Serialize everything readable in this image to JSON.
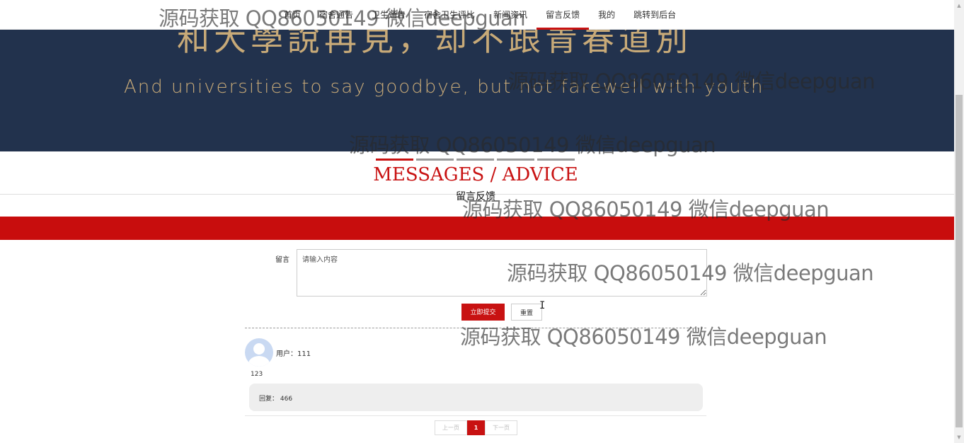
{
  "nav": {
    "items": [
      {
        "label": "首页"
      },
      {
        "label": "宿舍通告"
      },
      {
        "label": "卫生通告"
      },
      {
        "label": "宿舍卫生评比"
      },
      {
        "label": "新闻资讯"
      },
      {
        "label": "留言反馈"
      },
      {
        "label": "我的"
      },
      {
        "label": "跳转到后台"
      }
    ],
    "active": "留言反馈"
  },
  "banner": {
    "cn_text": "和大學說再見，却不跟青春道別",
    "en_text": "And universities to say goodbye, but not farewell with youth"
  },
  "section": {
    "title_en": "MESSAGES / ADVICE",
    "title_cn": "留言反馈"
  },
  "form": {
    "label": "留言",
    "placeholder": "请输入内容",
    "submit_label": "立即提交",
    "reset_label": "重置"
  },
  "comments": [
    {
      "user": "用户：111",
      "content": "123",
      "reply": "回复： 466"
    }
  ],
  "pagination": {
    "prev": "上一页",
    "current": "1",
    "next": "下一页"
  },
  "watermark": "源码获取 QQ86050149 微信deepguan",
  "colors": {
    "accent": "#c81212",
    "banner_bg": "#22324d",
    "banner_text": "#c8aa78"
  }
}
